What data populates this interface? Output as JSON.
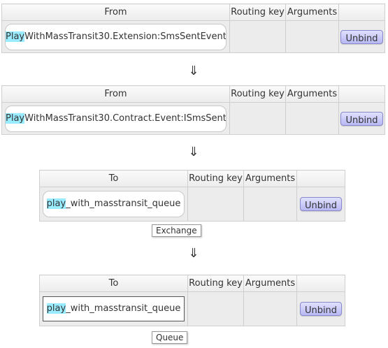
{
  "headers": {
    "from": "From",
    "to": "To",
    "routing_key": "Routing key",
    "arguments": "Arguments"
  },
  "bindings": [
    {
      "source_prefix": "Play",
      "source_rest": "WithMassTransit30.Extension:SmsSentEvent",
      "routing_key": "",
      "arguments": "",
      "unbind_label": "Unbind"
    },
    {
      "source_prefix": "Play",
      "source_rest": "WithMassTransit30.Contract.Event:ISmsSent",
      "routing_key": "",
      "arguments": "",
      "unbind_label": "Unbind"
    },
    {
      "dest_prefix": "play",
      "dest_rest": "_with_masstransit_queue",
      "routing_key": "",
      "arguments": "",
      "unbind_label": "Unbind",
      "type_label": "Exchange"
    },
    {
      "dest_prefix": "play",
      "dest_rest": "_with_masstransit_queue",
      "routing_key": "",
      "arguments": "",
      "unbind_label": "Unbind",
      "type_label": "Queue"
    }
  ],
  "arrow_glyph": "⇓"
}
